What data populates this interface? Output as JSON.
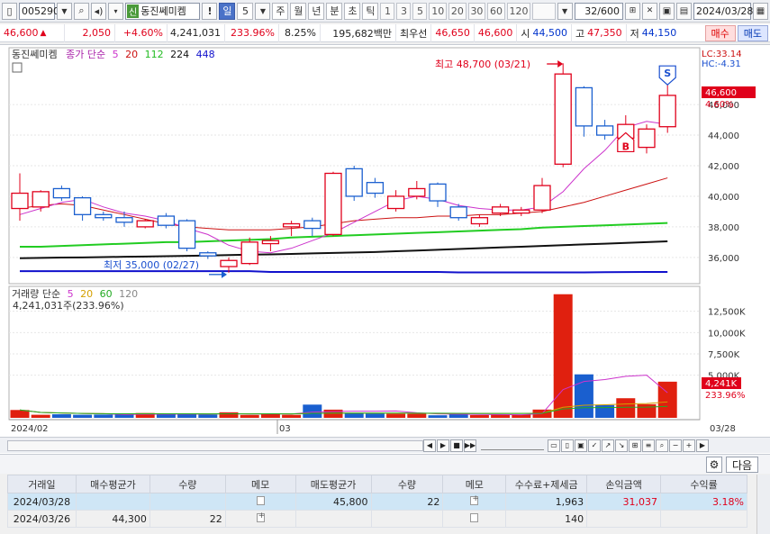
{
  "toolbar": {
    "code": "005290",
    "name_badge": "신",
    "name": "동진쎄미켐",
    "excl": "!",
    "periods": [
      "일",
      "5",
      "주",
      "월",
      "년",
      "분",
      "초",
      "틱"
    ],
    "active_period": "일",
    "nums": [
      "1",
      "3",
      "5",
      "10",
      "20",
      "30",
      "60",
      "120"
    ],
    "count": "32/600",
    "date": "2024/03/28"
  },
  "quote": {
    "price": "46,600",
    "arrow": "▲",
    "change": "2,050",
    "change_pct": "+4.60%",
    "volume": "4,241,031",
    "vol_ratio": "233.96%",
    "turnover": "8.25%",
    "amount": "195,682백만",
    "best_label": "최우선",
    "best_ask": "46,650",
    "best_bid": "46,600",
    "open_label": "시",
    "open": "44,500",
    "high_label": "고",
    "high": "47,350",
    "low_label": "저",
    "low": "44,150",
    "buy": "매수",
    "sell": "매도"
  },
  "legend": {
    "name": "동진쎄미켐",
    "ma_label": "종가 단순",
    "ma": [
      "5",
      "20",
      "112",
      "224",
      "448"
    ],
    "vol_label": "거래량 단순",
    "vol_ma": [
      "5",
      "20",
      "60",
      "120"
    ],
    "vol_value": "4,241,031주(233.96%)"
  },
  "annotations": {
    "high": "최고 48,700 (03/21)",
    "low": "최저 35,000 (02/27)",
    "lc": "LC:33.14",
    "hc": "HC:-4.31",
    "price_tag": "46,600",
    "pct_tag": "4.60%",
    "vol_tag": "4,241K",
    "vol_pct_tag": "233.96%",
    "buy_marker": "B",
    "sell_marker": "S"
  },
  "price_axis": [
    "46,000",
    "44,000",
    "42,000",
    "40,000",
    "38,000",
    "36,000"
  ],
  "volume_axis": [
    "12,500K",
    "10,000K",
    "7,500K",
    "5,000K"
  ],
  "date_axis": [
    "2024/02",
    "03",
    "03/28"
  ],
  "chart_data": {
    "type": "candlestick",
    "candles": [
      {
        "o": 39200,
        "c": 40200,
        "h": 41500,
        "l": 38400
      },
      {
        "o": 39300,
        "c": 40300,
        "h": 40400,
        "l": 39000
      },
      {
        "o": 40500,
        "c": 39900,
        "h": 40700,
        "l": 39700
      },
      {
        "o": 39900,
        "c": 38800,
        "h": 40000,
        "l": 38400
      },
      {
        "o": 38800,
        "c": 38600,
        "h": 39000,
        "l": 38400
      },
      {
        "o": 38600,
        "c": 38300,
        "h": 39000,
        "l": 38000
      },
      {
        "o": 38000,
        "c": 38400,
        "h": 38500,
        "l": 37900
      },
      {
        "o": 38700,
        "c": 38100,
        "h": 38900,
        "l": 37900
      },
      {
        "o": 38400,
        "c": 36600,
        "h": 38500,
        "l": 36400
      },
      {
        "o": 36300,
        "c": 36100,
        "h": 36400,
        "l": 35900
      },
      {
        "o": 35400,
        "c": 35800,
        "h": 36000,
        "l": 35000
      },
      {
        "o": 35600,
        "c": 37000,
        "h": 37300,
        "l": 35500
      },
      {
        "o": 36900,
        "c": 37100,
        "h": 37400,
        "l": 36400
      },
      {
        "o": 38000,
        "c": 38200,
        "h": 38400,
        "l": 37400
      },
      {
        "o": 38400,
        "c": 37900,
        "h": 38600,
        "l": 37400
      },
      {
        "o": 37500,
        "c": 41500,
        "h": 41600,
        "l": 37400
      },
      {
        "o": 41800,
        "c": 40000,
        "h": 42000,
        "l": 39700
      },
      {
        "o": 40900,
        "c": 40200,
        "h": 41200,
        "l": 39900
      },
      {
        "o": 39200,
        "c": 40000,
        "h": 40400,
        "l": 39000
      },
      {
        "o": 40000,
        "c": 40500,
        "h": 41000,
        "l": 39800
      },
      {
        "o": 40800,
        "c": 39700,
        "h": 40900,
        "l": 39300
      },
      {
        "o": 39300,
        "c": 38600,
        "h": 39500,
        "l": 38400
      },
      {
        "o": 38200,
        "c": 38600,
        "h": 38800,
        "l": 38000
      },
      {
        "o": 38900,
        "c": 39300,
        "h": 39500,
        "l": 38700
      },
      {
        "o": 38900,
        "c": 39100,
        "h": 39300,
        "l": 38700
      },
      {
        "o": 39100,
        "c": 40700,
        "h": 41200,
        "l": 38900
      },
      {
        "o": 42100,
        "c": 48000,
        "h": 48700,
        "l": 41900
      },
      {
        "o": 47100,
        "c": 44600,
        "h": 47200,
        "l": 43900
      },
      {
        "o": 44600,
        "c": 44000,
        "h": 45000,
        "l": 43700
      },
      {
        "o": 43800,
        "c": 44700,
        "h": 45300,
        "l": 43600
      },
      {
        "o": 43200,
        "c": 44400,
        "h": 44700,
        "l": 42800
      },
      {
        "o": 44550,
        "c": 46600,
        "h": 47350,
        "l": 44150
      }
    ],
    "volume_k": [
      920,
      360,
      420,
      360,
      380,
      380,
      560,
      420,
      420,
      380,
      650,
      330,
      520,
      350,
      1550,
      960,
      540,
      500,
      470,
      470,
      300,
      420,
      320,
      380,
      380,
      970,
      14500,
      5100,
      1500,
      2300,
      1600,
      4241
    ],
    "ma5": [
      38800,
      39200,
      39600,
      39800,
      39300,
      38900,
      38700,
      38400,
      37900,
      37500,
      36800,
      36400,
      36300,
      36600,
      37100,
      37600,
      38300,
      39000,
      39700,
      40000,
      39800,
      39400,
      39200,
      39100,
      39100,
      39300,
      40300,
      41800,
      43000,
      44500,
      44900,
      44700
    ],
    "ma20": [
      39200,
      39400,
      39500,
      39400,
      39100,
      38800,
      38500,
      38200,
      38000,
      37900,
      37800,
      37800,
      37800,
      37900,
      38000,
      38200,
      38400,
      38500,
      38600,
      38600,
      38700,
      38700,
      38800,
      38800,
      38900,
      39000,
      39300,
      39600,
      40000,
      40400,
      40800,
      41200
    ],
    "ma112": [
      36700,
      36700,
      36750,
      36800,
      36850,
      36900,
      36950,
      37000,
      37000,
      37050,
      37100,
      37150,
      37200,
      37300,
      37350,
      37400,
      37450,
      37500,
      37550,
      37600,
      37650,
      37700,
      37750,
      37800,
      37850,
      37950,
      38000,
      38050,
      38100,
      38150,
      38200,
      38250
    ],
    "ma224": [
      35950,
      35970,
      35990,
      36000,
      36020,
      36040,
      36060,
      36080,
      36100,
      36120,
      36150,
      36180,
      36200,
      36230,
      36260,
      36290,
      36320,
      36350,
      36400,
      36450,
      36500,
      36550,
      36600,
      36650,
      36700,
      36750,
      36800,
      36850,
      36900,
      36950,
      37000,
      37050
    ],
    "ma448": [
      35100,
      35100,
      35100,
      35100,
      35100,
      35100,
      35100,
      35100,
      35100,
      35100,
      35100,
      35100,
      35050,
      35050,
      35050,
      35050,
      35050,
      35050,
      35050,
      35050,
      35050,
      35020,
      35020,
      35020,
      35020,
      35020,
      35020,
      35020,
      35030,
      35040,
      35050,
      35050
    ],
    "price_range": [
      34400,
      49600
    ],
    "volume_range": [
      0,
      15000
    ]
  },
  "table": {
    "headers": [
      "거래일",
      "매수평균가",
      "수량",
      "메모",
      "매도평균가",
      "수량",
      "메모",
      "수수료+제세금",
      "손익금액",
      "수익률"
    ],
    "rows": [
      {
        "date": "2024/03/28",
        "buy_avg": "",
        "buy_qty": "",
        "sell_avg": "45,800",
        "sell_qty": "22",
        "fee": "1,963",
        "pnl": "31,037",
        "ret": "3.18%"
      },
      {
        "date": "2024/03/26",
        "buy_avg": "44,300",
        "buy_qty": "22",
        "sell_avg": "",
        "sell_qty": "",
        "fee": "140",
        "pnl": "",
        "ret": ""
      }
    ]
  },
  "panel": {
    "next": "다음"
  },
  "colors": {
    "up": "#e0001b",
    "down": "#1a5fcf",
    "ma5": "#cc33cc",
    "ma20": "#cc1111",
    "ma112": "#22cc22",
    "ma224": "#111111",
    "ma448": "#1111cc"
  }
}
